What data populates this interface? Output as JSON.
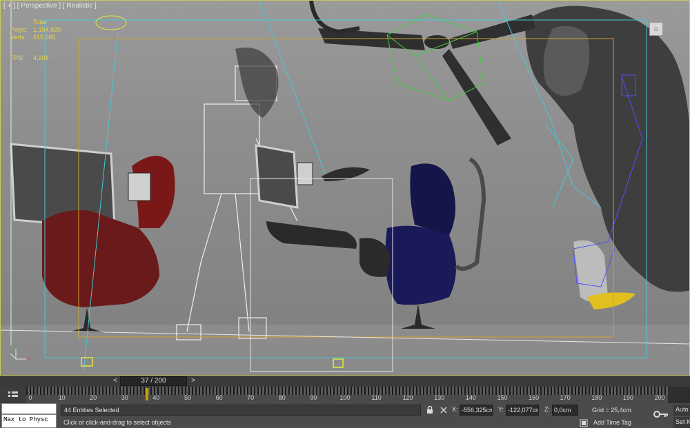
{
  "viewport": {
    "label_plus": "[ + ]",
    "label_view": "[ Perspective ]",
    "label_shading": "[ Realistic ]",
    "stats": {
      "total_label": "Total",
      "polys_label": "Polys:",
      "polys_value": "1.164.920",
      "verts_label": "Verts:",
      "verts_value": "615.065",
      "fps_label": "FPS:",
      "fps_value": "4,208"
    },
    "corner_icon": "viewcube-icon",
    "colors": {
      "stats": "#e8d44a",
      "safe_frame_outer": "#c8c85a",
      "safe_frame_inner": "#d4a030",
      "camera_lines": "#46c8d8",
      "selection_green": "#40d040"
    }
  },
  "time_slider": {
    "prev_label": "<",
    "position": "37 / 200",
    "next_label": ">"
  },
  "track_bar": {
    "icon": "track-bar-toggle-icon",
    "ticks": [
      "0",
      "10",
      "20",
      "30",
      "40",
      "50",
      "60",
      "70",
      "80",
      "90",
      "100",
      "110",
      "120",
      "130",
      "140",
      "150",
      "160",
      "170",
      "180",
      "190",
      "200"
    ],
    "current_frame": 37,
    "frame_max": 200
  },
  "status": {
    "maxscript_text": "Max to Physc",
    "selected_text": "44 Entities Selected",
    "prompt_text": "Click or click-and-drag to select objects",
    "x_label": "X:",
    "x_value": "-556,325cm",
    "y_label": "Y:",
    "y_value": "-122,077cm",
    "z_label": "Z:",
    "z_value": "0,0cm",
    "grid_text": "Grid = 25,4cm",
    "add_time_tag": "Add Time Tag",
    "auto_label": "Auto",
    "setk_label": "Set K"
  }
}
